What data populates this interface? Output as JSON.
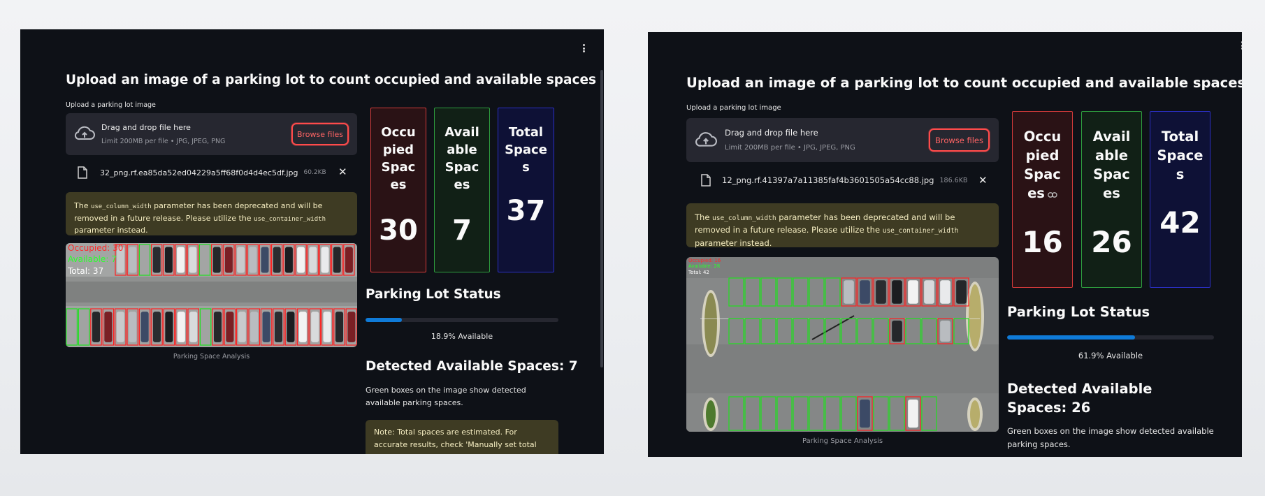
{
  "left": {
    "title": "Upload an image of a parking lot to count occupied and available spaces",
    "upload_label": "Upload a parking lot image",
    "dropzone": {
      "text": "Drag and drop file here",
      "limit": "Limit 200MB per file • JPG, JPEG, PNG",
      "browse_label": "Browse files"
    },
    "file": {
      "name": "32_png.rf.ea85da52ed04229a5ff68f0d4d4ec5df.jpg",
      "size": "60.2KB"
    },
    "warning": {
      "pre": "The ",
      "code1": "use_column_width",
      "mid": " parameter has been deprecated and will be removed in a future release. Please utilize the ",
      "code2": "use_container_width",
      "post": " parameter instead."
    },
    "overlay": {
      "occupied": "Occupied:",
      "occupied_value": "30",
      "available": "Available:",
      "available_value": "7",
      "total": "Total:",
      "total_value": "37"
    },
    "caption": "Parking Space Analysis",
    "metrics": [
      {
        "label": "Occupied Spaces",
        "value": "30",
        "color": "#d33a3a",
        "bg": "#2a1215"
      },
      {
        "label": "Available Spaces",
        "value": "7",
        "color": "#2e9e3e",
        "bg": "#112016"
      },
      {
        "label": "Total Spaces",
        "value": "37",
        "color": "#2b2fc4",
        "bg": "#0e1136"
      }
    ],
    "status_heading": "Parking Lot Status",
    "progress": {
      "fraction": 0.189,
      "text": "18.9% Available"
    },
    "detected_heading": "Detected Available Spaces: 7",
    "detected_desc": "Green boxes on the image show detected available parking spaces.",
    "note": "Note: Total spaces are estimated. For accurate results, check 'Manually set total parking spaces'"
  },
  "right": {
    "title": "Upload an image of a parking lot to count occupied and available spaces",
    "upload_label": "Upload a parking lot image",
    "dropzone": {
      "text": "Drag and drop file here",
      "limit": "Limit 200MB per file • JPG, JPEG, PNG",
      "browse_label": "Browse files"
    },
    "file": {
      "name": "12_png.rf.41397a7a11385faf4b3601505a54cc88.jpg",
      "size": "186.6KB"
    },
    "warning": {
      "pre": "The ",
      "code1": "use_column_width",
      "mid": " parameter has been deprecated and will be removed in a future release. Please utilize the ",
      "code2": "use_container_width",
      "post": " parameter instead."
    },
    "overlay": {
      "occupied": "Occupied:",
      "occupied_value": "16",
      "available": "Available:",
      "available_value": "26",
      "total": "Total:",
      "total_value": "42"
    },
    "caption": "Parking Space Analysis",
    "metrics": [
      {
        "label": "Occupied Spaces",
        "value": "16",
        "color": "#d33a3a",
        "bg": "#2a1215"
      },
      {
        "label": "Available Spaces",
        "value": "26",
        "color": "#2e9e3e",
        "bg": "#112016"
      },
      {
        "label": "Total Spaces",
        "value": "42",
        "color": "#2b2fc4",
        "bg": "#0e1136"
      }
    ],
    "status_heading": "Parking Lot Status",
    "progress": {
      "fraction": 0.619,
      "text": "61.9% Available"
    },
    "detected_heading": "Detected Available Spaces: 26",
    "detected_desc": "Green boxes on the image show detected available parking spaces."
  },
  "icons": {
    "menu": "vertical-ellipsis-icon",
    "upload": "cloud-upload-icon",
    "file": "file-icon",
    "close": "close-icon",
    "link": "link-icon"
  }
}
